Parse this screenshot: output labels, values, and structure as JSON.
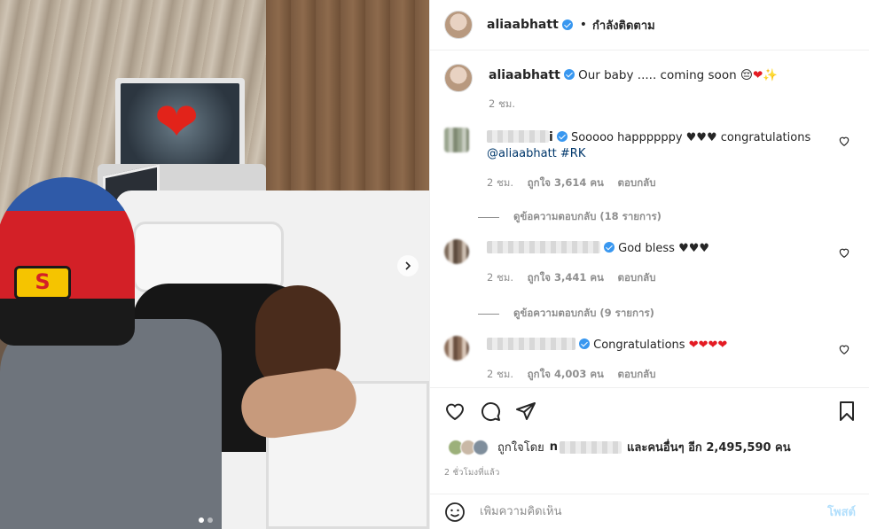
{
  "header": {
    "username": "aliaabhatt",
    "separator": "•",
    "follow_label": "กำลังติดตาม"
  },
  "caption": {
    "username": "aliaabhatt",
    "text": "Our baby ..... coming soon 😔",
    "hearts": "❤",
    "sparkle": "✨",
    "age": "2 ชม."
  },
  "comments": [
    {
      "name_suffix": "i",
      "text": "Sooooo happppppy ♥♥♥ congratulations",
      "link": "@aliaabhatt #RK",
      "age": "2 ชม.",
      "likes": "ถูกใจ 3,614 คน",
      "reply": "ตอบกลับ",
      "view_replies": "ดูข้อความตอบกลับ (18 รายการ)"
    },
    {
      "text": "God bless ♥♥♥",
      "age": "2 ชม.",
      "likes": "ถูกใจ 3,441 คน",
      "reply": "ตอบกลับ",
      "view_replies": "ดูข้อความตอบกลับ (9 รายการ)"
    },
    {
      "text": "Congratulations",
      "hearts": "❤❤❤❤",
      "age": "2 ชม.",
      "likes": "ถูกใจ 4,003 คน",
      "reply": "ตอบกลับ"
    }
  ],
  "liked_by": {
    "prefix": "ถูกใจโดย",
    "name_start": "n",
    "suffix": "และคนอื่นๆ อีก 2,495,590 คน"
  },
  "timestamp": "2 ชั่วโมงที่แล้ว",
  "add_comment": {
    "placeholder": "เพิ่มความคิดเห็น",
    "post_label": "โพสต์"
  },
  "photo": {
    "cap_logo": "S",
    "carousel_pages": 2,
    "current_page": 1
  },
  "colors": {
    "verified": "#3897f0",
    "heart": "#e41b23",
    "post_disabled": "#b2dffc",
    "link": "#00376b"
  },
  "icons": [
    "heart-icon",
    "comment-icon",
    "share-icon",
    "bookmark-icon",
    "emoji-icon",
    "chevron-right-icon",
    "verified-icon"
  ]
}
